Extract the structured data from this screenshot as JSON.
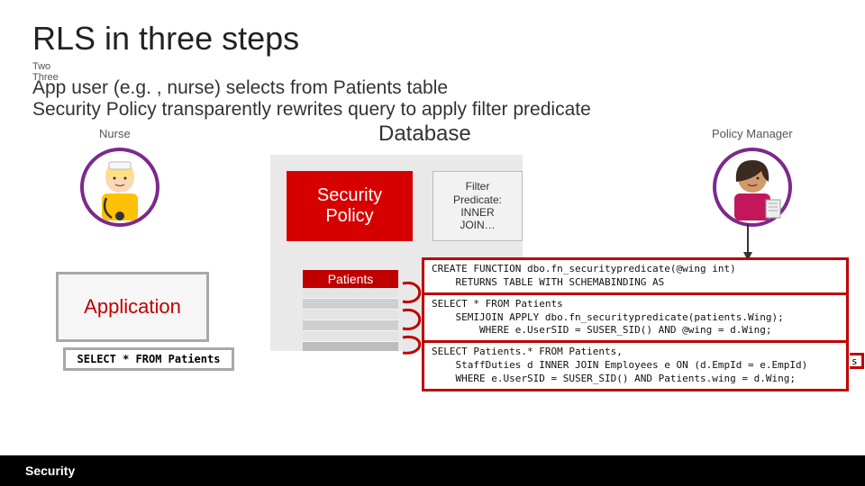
{
  "title": "RLS in three steps",
  "tab_label": "Two\nThree",
  "subtitle1": "App user (e.g. , nurse) selects from Patients table",
  "subtitle2": "Security Policy transparently rewrites query to apply filter predicate",
  "labels": {
    "nurse": "Nurse",
    "database": "Database",
    "policy_manager": "Policy Manager",
    "security_policy": "Security\nPolicy",
    "filter_predicate": "Filter\nPredicate:\nINNER\nJOIN…",
    "patients": "Patients",
    "application": "Application"
  },
  "query": "SELECT * FROM Patients",
  "code": {
    "block1": "CREATE FUNCTION dbo.fn_securitypredicate(@wing int)\n    RETURNS TABLE WITH SCHEMABINDING AS",
    "block2": "SELECT * FROM Patients\n    SEMIJOIN APPLY dbo.fn_securitypredicate(patients.Wing);",
    "block2b": "        WHERE e.UserSID = SUSER_SID() AND @wing = d.Wing;",
    "block3": "SELECT Patients.* FROM Patients,\n    StaffDuties d INNER JOIN Employees e ON (d.EmpId = e.EmpId)\n    WHERE e.UserSID = SUSER_SID() AND Patients.wing = d.Wing;",
    "overhang": "s"
  },
  "footer": "Security",
  "colors": {
    "accent": "#c00000",
    "slide_bg": "#ffffff"
  }
}
